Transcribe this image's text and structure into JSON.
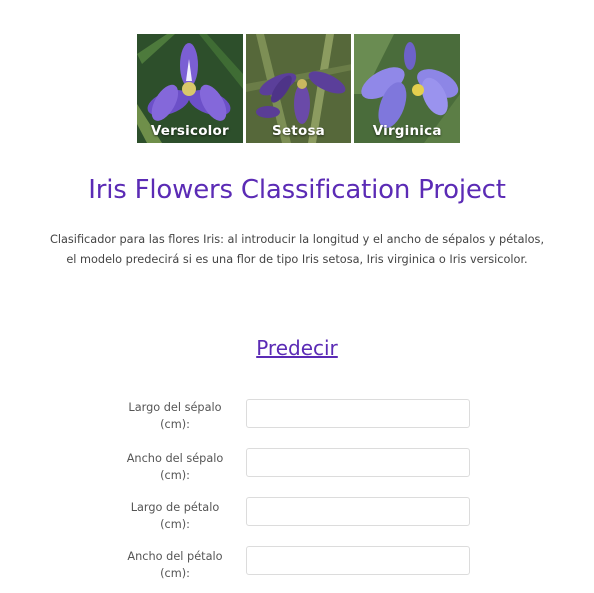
{
  "banner": {
    "flowers": [
      {
        "label": "Versicolor",
        "petal_color": "#7b5fd4",
        "bg_color": "#2f5a2a"
      },
      {
        "label": "Setosa",
        "petal_color": "#6a4aa8",
        "bg_color": "#5a6b3a"
      },
      {
        "label": "Virginica",
        "petal_color": "#8d86e6",
        "bg_color": "#4a6e3c"
      }
    ]
  },
  "header": {
    "title": "Iris Flowers Classification Project",
    "description_line1": "Clasificador para las flores Iris: al introducir la longitud y el ancho de sépalos y pétalos,",
    "description_line2": "el modelo predecirá si es una flor de tipo Iris setosa, Iris virginica o Iris versicolor."
  },
  "predict": {
    "link_label": "Predecir"
  },
  "form": {
    "fields": [
      {
        "label_line1": "Largo del sépalo",
        "label_line2": "(cm):",
        "value": ""
      },
      {
        "label_line1": "Ancho del sépalo",
        "label_line2": "(cm):",
        "value": ""
      },
      {
        "label_line1": "Largo de pétalo",
        "label_line2": "(cm):",
        "value": ""
      },
      {
        "label_line1": "Ancho del pétalo",
        "label_line2": "(cm):",
        "value": ""
      }
    ]
  },
  "colors": {
    "accent": "#5b2bb5",
    "text": "#444444"
  }
}
